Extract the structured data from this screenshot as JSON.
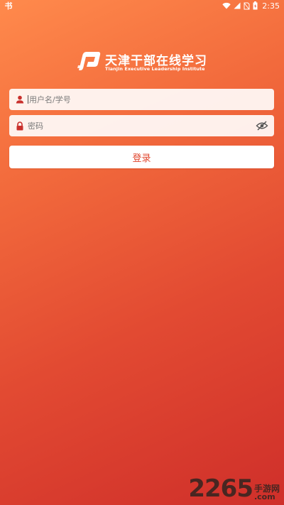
{
  "status_bar": {
    "app_badge": "书",
    "time": "2:35",
    "icons": [
      "wifi-icon",
      "signal-icon",
      "no-sim-icon",
      "battery-icon"
    ]
  },
  "logo": {
    "title": "天津干部在线学习",
    "subtitle": "Tianjin Executive Leadership Institute"
  },
  "login_form": {
    "username_placeholder": "用户名/学号",
    "username_value": "",
    "password_placeholder": "密码",
    "password_value": "",
    "login_label": "登录"
  },
  "watermark": {
    "digits": "2265",
    "cn": "手游网",
    "en": ".com"
  },
  "colors": {
    "gradient_start": "#ff8a4c",
    "gradient_end": "#cf2f2a",
    "accent": "#e0452d",
    "icon_red": "#c9302c"
  }
}
